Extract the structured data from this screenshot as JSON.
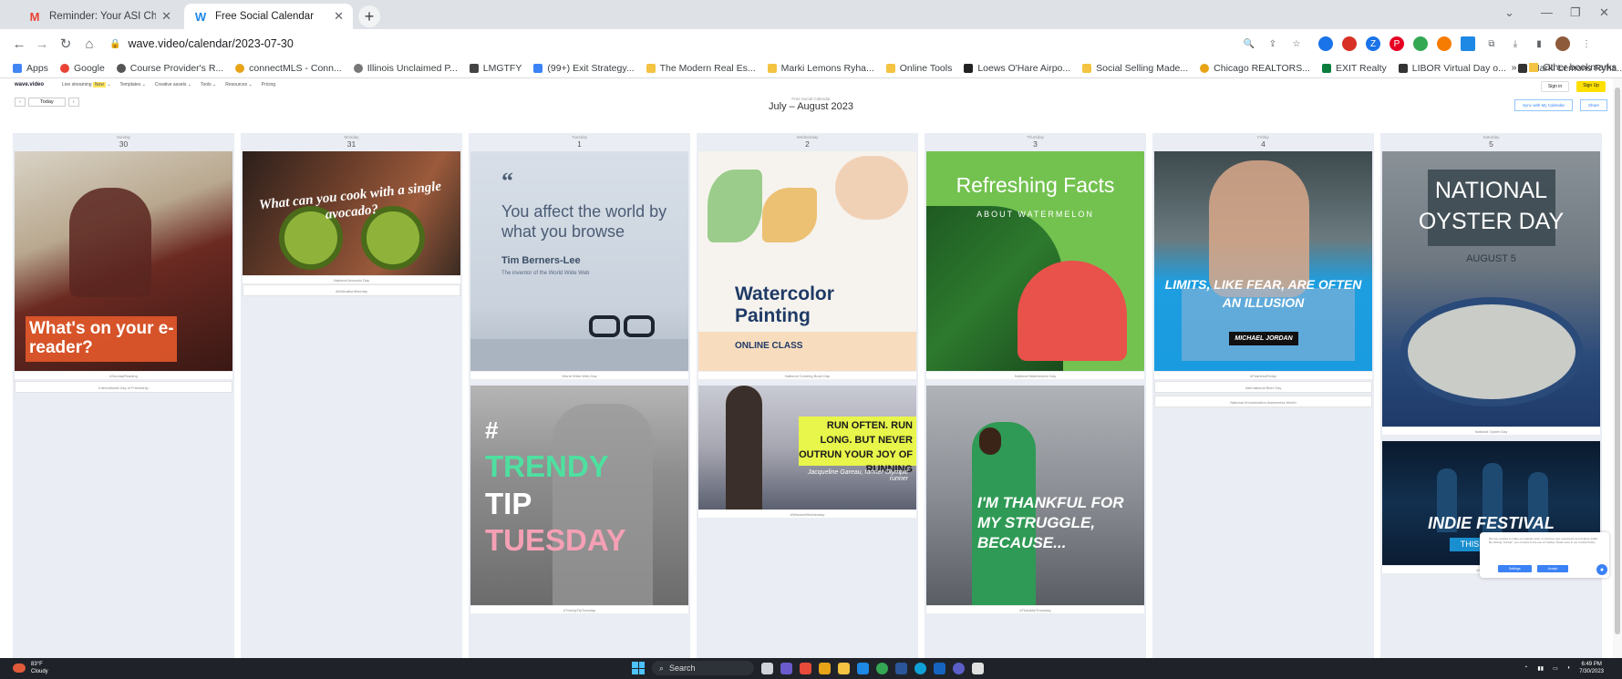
{
  "browser": {
    "tabs": [
      {
        "title": "Reminder: Your ASI Chicago Po",
        "favicon": "gmail-icon",
        "active": false
      },
      {
        "title": "Free Social Calendar",
        "favicon": "wave-icon",
        "active": true
      }
    ],
    "url": "wave.video/calendar/2023-07-30",
    "bookmarks": [
      {
        "label": "Apps",
        "color": "#4285f4"
      },
      {
        "label": "Google",
        "color": "#ea4335"
      },
      {
        "label": "Course Provider's R...",
        "color": "#555555"
      },
      {
        "label": "connectMLS - Conn...",
        "color": "#e8a317"
      },
      {
        "label": "Illinois Unclaimed P...",
        "color": "#777777"
      },
      {
        "label": "LMGTFY",
        "color": "#444444"
      },
      {
        "label": "(99+) Exit Strategy...",
        "color": "#3b82f6"
      },
      {
        "label": "The Modern Real Es...",
        "color": "#f3c341"
      },
      {
        "label": "Marki Lemons Ryha...",
        "color": "#f3c341"
      },
      {
        "label": "Online Tools",
        "color": "#f3c341"
      },
      {
        "label": "Loews O'Hare Airpo...",
        "color": "#222222"
      },
      {
        "label": "Social Selling Made...",
        "color": "#f3c341"
      },
      {
        "label": "Chicago REALTORS...",
        "color": "#e8a317"
      },
      {
        "label": "EXIT Realty",
        "color": "#0a7d3e"
      },
      {
        "label": "LIBOR Virtual Day o...",
        "color": "#333333"
      },
      {
        "label": "Marki Lemons Ryha...",
        "color": "#333333"
      }
    ],
    "more_bookmarks": "»",
    "other_bookmarks": "Other bookmarks"
  },
  "site": {
    "logo": "wave.video",
    "nav": [
      "Live streaming",
      "Templates",
      "Creative assets",
      "Tools",
      "Resources",
      "Pricing"
    ],
    "new_badge": "New",
    "sign_in": "Sign in",
    "sign_up": "Sign Up"
  },
  "calendar": {
    "today": "Today",
    "subtitle": "Free Social Calendar",
    "title": "July – August 2023",
    "sync_button": "Sync with My Calendar",
    "share_button": "Share",
    "days": [
      {
        "name": "Sunday",
        "date": "30",
        "cards": [
          {
            "caption": "#SundayReading",
            "text": "What's on your e-reader?"
          }
        ],
        "tags": [
          "International Day of Friendship"
        ]
      },
      {
        "name": "Monday",
        "date": "31",
        "cards": [
          {
            "caption": "National Avocado Day",
            "text": "What can you cook with a single avocado?"
          }
        ],
        "tags": [
          "#MotivationMonday"
        ]
      },
      {
        "name": "Tuesday",
        "date": "1",
        "cards": [
          {
            "caption": "World Wide Web Day",
            "quote_mark": "“",
            "text": "You affect the world by what you browse",
            "author": "Tim Berners-Lee",
            "author_sub": "The inventor of the World Wide Web"
          },
          {
            "caption": "#TrendyTipTuesday",
            "hash": "#",
            "word1": "TRENDY",
            "word2": "TIP",
            "word3": "TUESDAY"
          }
        ],
        "tags": []
      },
      {
        "name": "Wednesday",
        "date": "2",
        "cards": [
          {
            "caption": "National Coloring Book Day",
            "line1": "Watercolor",
            "line2": "Painting",
            "line3": "ONLINE CLASS"
          },
          {
            "caption": "#WisdomWednesday",
            "text": "RUN OFTEN. RUN LONG. BUT NEVER OUTRUN YOUR JOY OF RUNNING",
            "author": "Jacqueline Gareau, former Olympic runner"
          }
        ],
        "tags": []
      },
      {
        "name": "Thursday",
        "date": "3",
        "cards": [
          {
            "caption": "National Watermelon Day",
            "title": "Refreshing Facts",
            "sub": "ABOUT WATERMELON"
          },
          {
            "caption": "#ThankfulThursday",
            "text": "I'M THANKFUL FOR MY STRUGGLE, BECAUSE..."
          }
        ],
        "tags": []
      },
      {
        "name": "Friday",
        "date": "4",
        "cards": [
          {
            "caption": "#FearlessFriday",
            "text": "LIMITS, LIKE FEAR, ARE OFTEN AN ILLUSION",
            "author": "MICHAEL JORDAN"
          }
        ],
        "tags": [
          "International Beer Day",
          "National Immunization Awareness Month"
        ]
      },
      {
        "name": "Saturday",
        "date": "5",
        "cards": [
          {
            "caption": "National Oyster Day",
            "line1": "NATIONAL",
            "line2": "OYSTER DAY",
            "date_text": "AUGUST 5"
          },
          {
            "caption": "#ConcertSaturday",
            "title": "INDIE FESTIVAL",
            "sub": "THIS WEEKEND"
          }
        ],
        "tags": []
      }
    ]
  },
  "cookie": {
    "text": "We use cookies to make our website work, to improve your experience and analyze traffic. By clicking \"Accept\", you consent to the use of cookies. Read more in our Cookie Policy.",
    "settings": "Settings",
    "accept": "Accept"
  },
  "taskbar": {
    "temp": "83°F",
    "condition": "Cloudy",
    "search": "Search",
    "time": "6:49 PM",
    "date": "7/30/2023"
  }
}
